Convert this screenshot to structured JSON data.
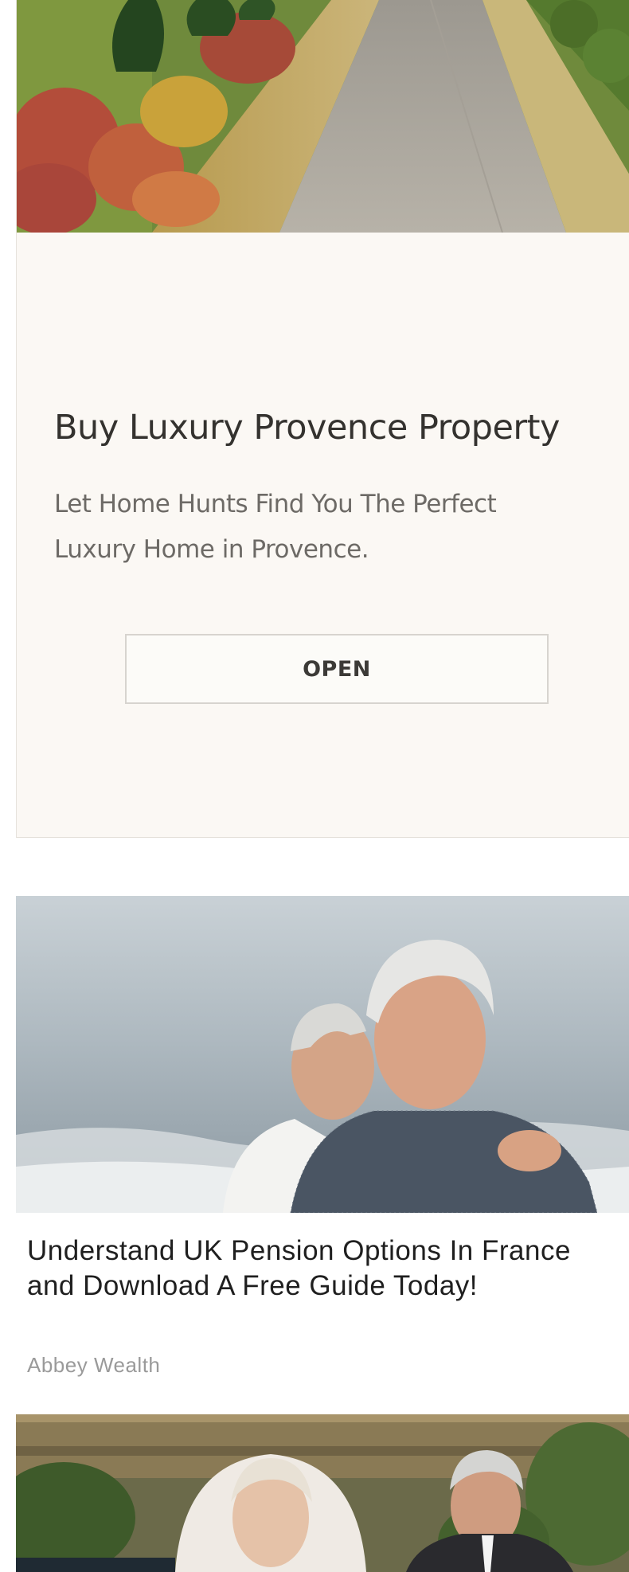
{
  "ad": {
    "title": "Buy Luxury Provence Property",
    "description": "Let Home Hunts Find You The Perfect Luxury Home in Provence.",
    "button_label": "OPEN",
    "image_alt": "driveway-lined-with-cypress-trees"
  },
  "articles": [
    {
      "title": "Understand UK Pension Options In France and Download A Free Guide Today!",
      "source": "Abbey Wealth",
      "image_alt": "smiling-older-couple-by-the-sea"
    },
    {
      "image_alt": "bride-and-older-man-outdoors"
    }
  ],
  "colors": {
    "card_background": "#fbf8f4",
    "title_text": "#34322f",
    "description_text": "#6d6a66",
    "button_border": "#d7d4cf",
    "article_title": "#1f1f1f",
    "article_source": "#9a9a9a"
  }
}
